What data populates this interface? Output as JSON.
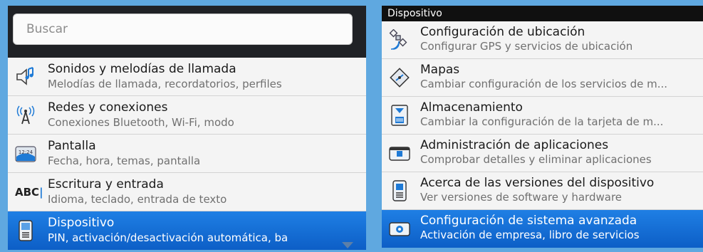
{
  "left": {
    "search_placeholder": "Buscar",
    "items": [
      {
        "title": "Sonidos y melodías de llamada",
        "subtitle": "Melodías de llamada, recordatorios, perfiles",
        "icon": "speaker-icon"
      },
      {
        "title": "Redes y conexiones",
        "subtitle": "Conexiones Bluetooth, Wi-Fi, modo",
        "icon": "antenna-icon"
      },
      {
        "title": "Pantalla",
        "subtitle": "Fecha, hora, temas, pantalla",
        "icon": "display-icon",
        "icon_text": "12:24"
      },
      {
        "title": "Escritura y entrada",
        "subtitle": "Idioma, teclado, entrada de texto",
        "icon": "abc-icon",
        "icon_text": "ABC"
      },
      {
        "title": "Dispositivo",
        "subtitle": "PIN, activación/desactivación automática, ba",
        "icon": "device-icon",
        "selected": true
      }
    ]
  },
  "right": {
    "header": "Dispositivo",
    "items": [
      {
        "title": "Configuración de ubicación",
        "subtitle": "Configurar GPS y servicios de ubicación",
        "icon": "satellite-icon"
      },
      {
        "title": "Mapas",
        "subtitle": "Cambiar configuración de los servicios de m...",
        "icon": "map-icon"
      },
      {
        "title": "Almacenamiento",
        "subtitle": "Cambiar la configuración de la tarjeta de m...",
        "icon": "storage-icon"
      },
      {
        "title": "Administración de aplicaciones",
        "subtitle": "Comprobar detalles y eliminar aplicaciones",
        "icon": "app-management-icon"
      },
      {
        "title": "Acerca de las versiones del dispositivo",
        "subtitle": "Ver versiones de software y hardware",
        "icon": "device-info-icon"
      },
      {
        "title": "Configuración de sistema avanzada",
        "subtitle": "Activación de empresa, libro de servicios",
        "icon": "advanced-settings-icon",
        "selected": true
      }
    ]
  },
  "colors": {
    "selected_start": "#1f7fe4",
    "selected_end": "#0d5fc7",
    "background": "#5fa8e0"
  }
}
